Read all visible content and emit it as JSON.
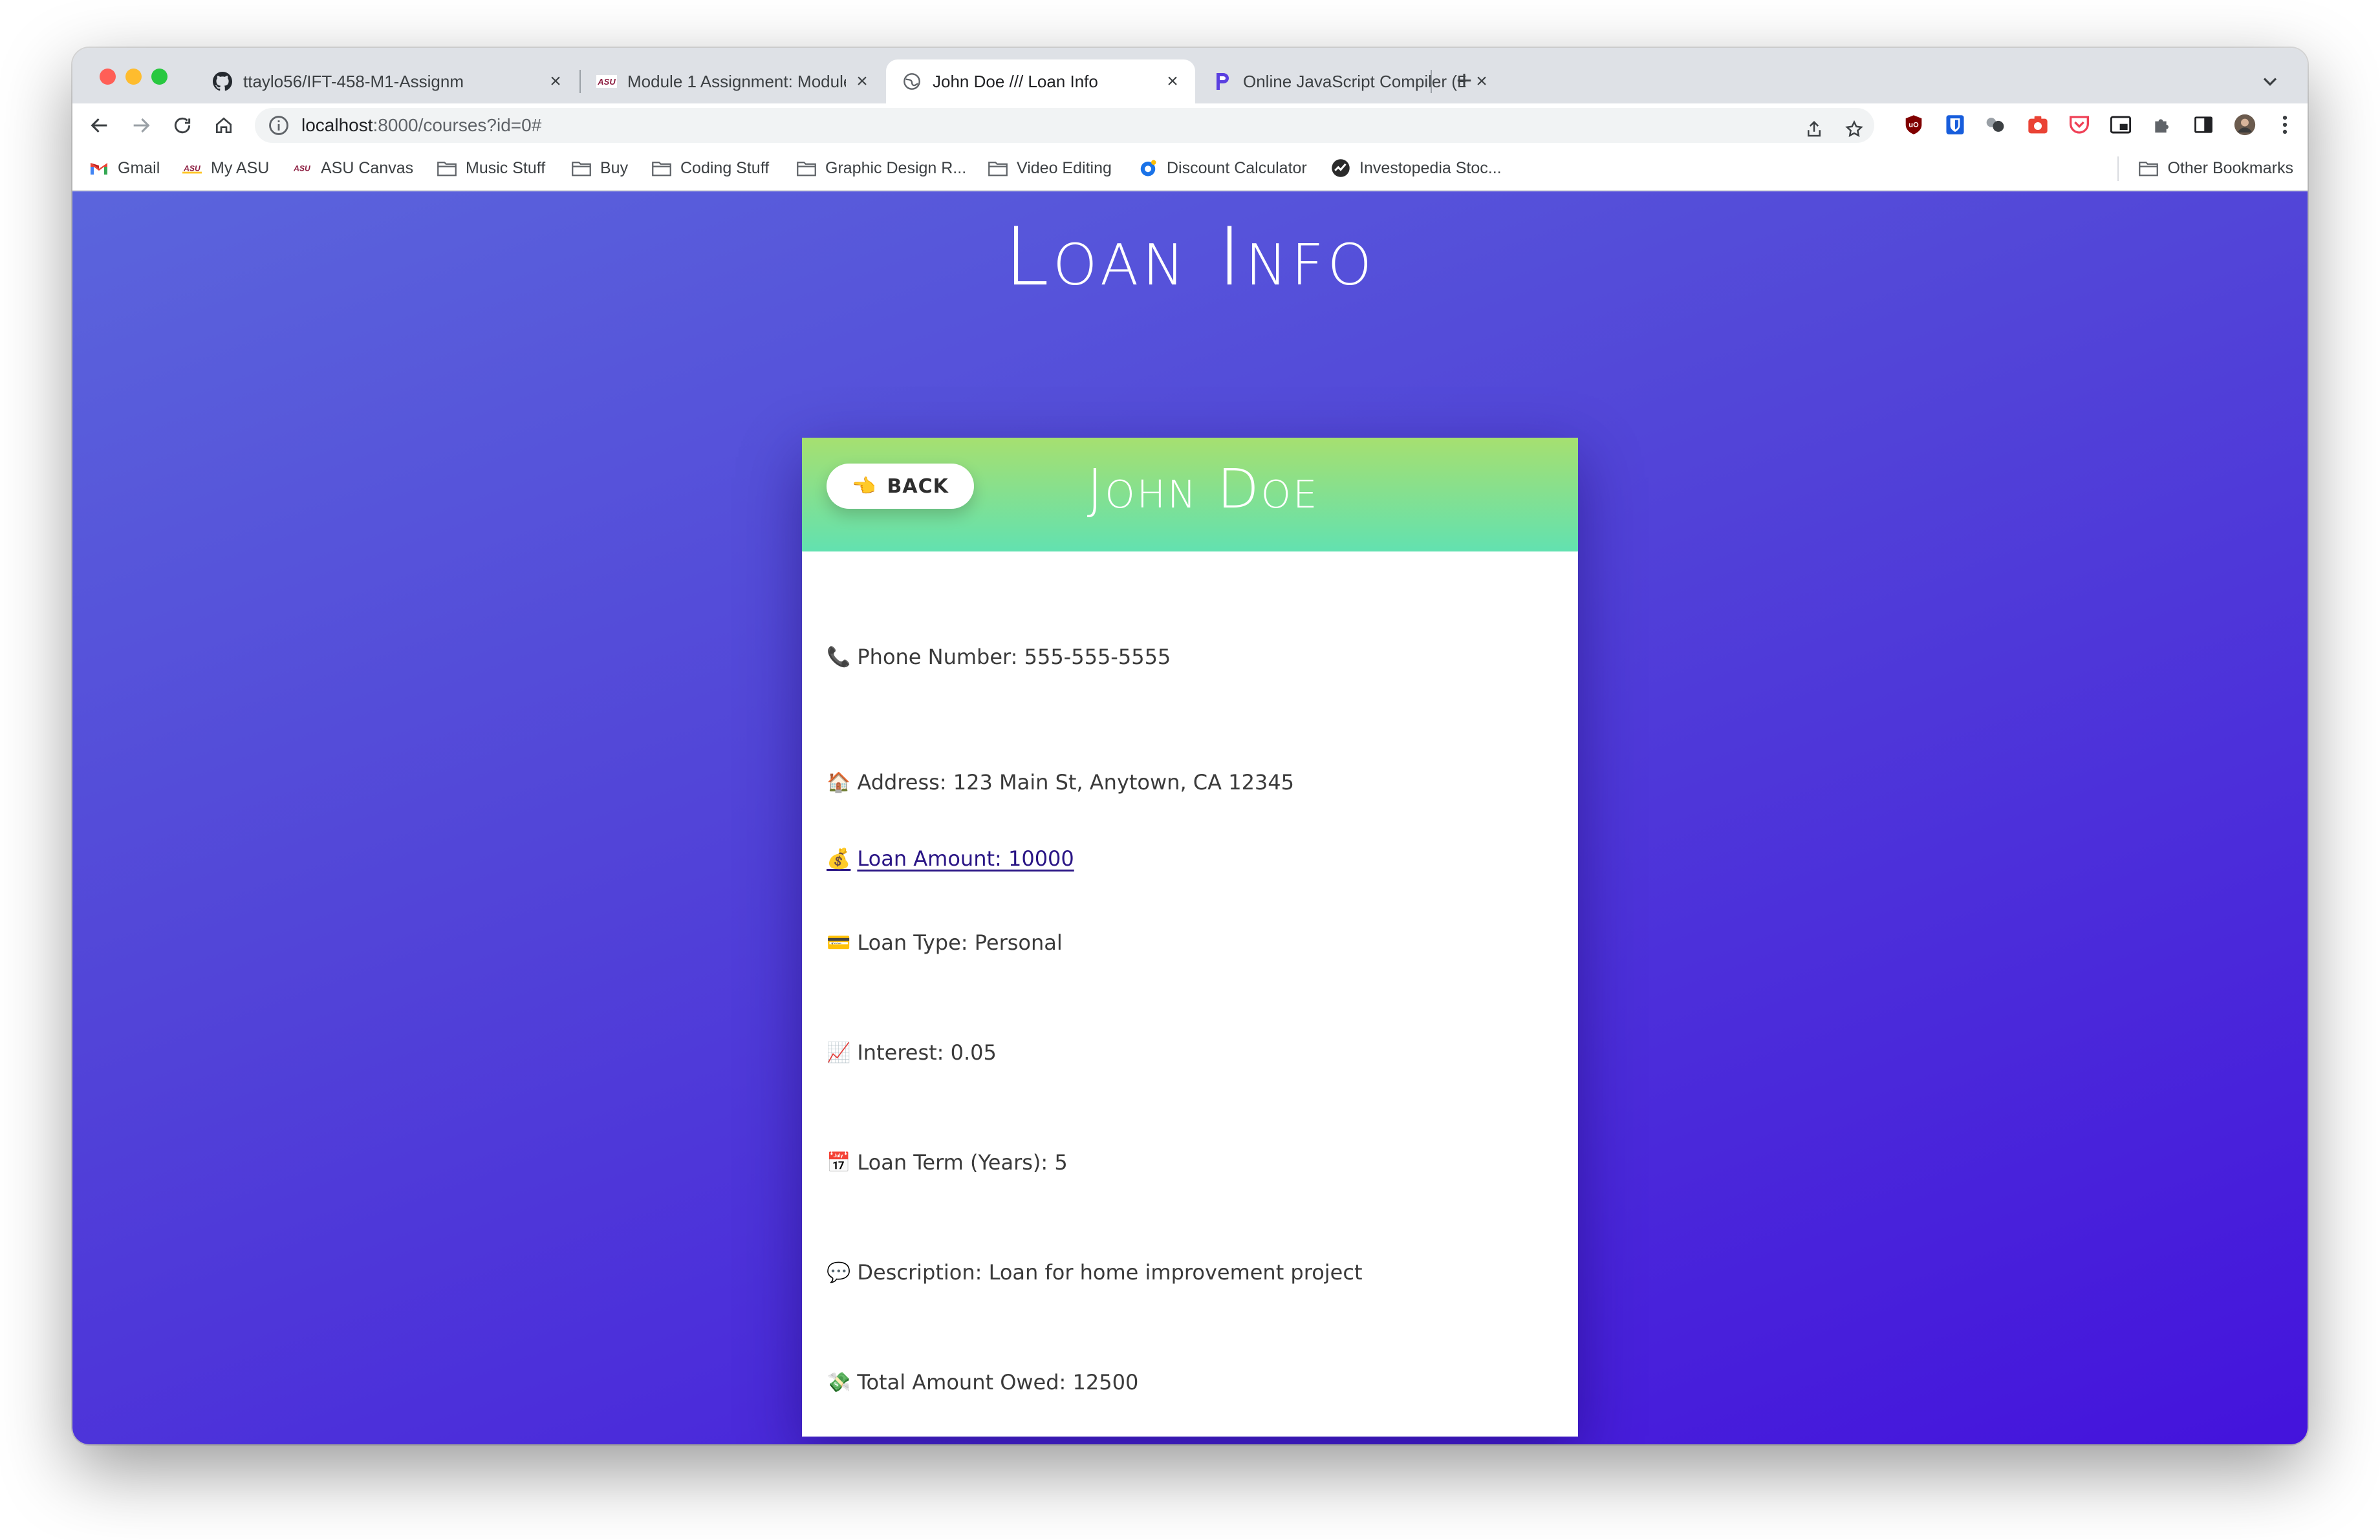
{
  "browser": {
    "tabs": [
      {
        "label": "ttaylo56/IFT-458-M1-Assignm",
        "icon": "github-icon"
      },
      {
        "label": "Module 1 Assignment: Modules",
        "icon": "asu-icon"
      },
      {
        "label": "John Doe /// Loan Info",
        "icon": "globe-icon"
      },
      {
        "label": "Online JavaScript Compiler (Ed",
        "icon": "programiz-icon"
      }
    ],
    "address": {
      "host": "localhost",
      "path": ":8000/courses?id=0#"
    },
    "bookmarks": [
      {
        "label": "Gmail",
        "icon": "gmail-icon"
      },
      {
        "label": "My ASU",
        "icon": "asu-icon"
      },
      {
        "label": "ASU Canvas",
        "icon": "asu-icon"
      },
      {
        "label": "Music Stuff",
        "icon": "folder-icon"
      },
      {
        "label": "Buy",
        "icon": "folder-icon"
      },
      {
        "label": "Coding Stuff",
        "icon": "folder-icon"
      },
      {
        "label": "Graphic Design R...",
        "icon": "folder-icon"
      },
      {
        "label": "Video Editing",
        "icon": "folder-icon"
      },
      {
        "label": "Discount Calculator",
        "icon": "discount-icon"
      },
      {
        "label": "Investopedia Stoc...",
        "icon": "investopedia-icon"
      }
    ],
    "other_bookmarks": "Other Bookmarks"
  },
  "page": {
    "title": "Loan Info",
    "back_label": "BACK",
    "back_icon": "👈",
    "name": "John Doe",
    "fields": {
      "phone": {
        "icon": "📞",
        "text": "Phone Number: 555-555-5555"
      },
      "address": {
        "icon": "🏠",
        "text": "Address: 123 Main St, Anytown, CA 12345"
      },
      "loan_amount": {
        "icon": "💰",
        "text": "Loan Amount: 10000"
      },
      "loan_type": {
        "icon": "💳",
        "text": "Loan Type: Personal"
      },
      "interest": {
        "icon": "📈",
        "text": "Interest: 0.05"
      },
      "loan_term": {
        "icon": "📅",
        "text": "Loan Term (Years): 5"
      },
      "description": {
        "icon": "💬",
        "text": "Description: Loan for home improvement project"
      },
      "total_owed": {
        "icon": "💸",
        "text": "Total Amount Owed: 12500"
      }
    }
  },
  "colors": {
    "page_gradient_start": "#5b65dc",
    "page_gradient_end": "#4413dc",
    "card_header_top": "#a6e070",
    "card_header_bottom": "#62e1b0",
    "link": "#2a1585"
  }
}
